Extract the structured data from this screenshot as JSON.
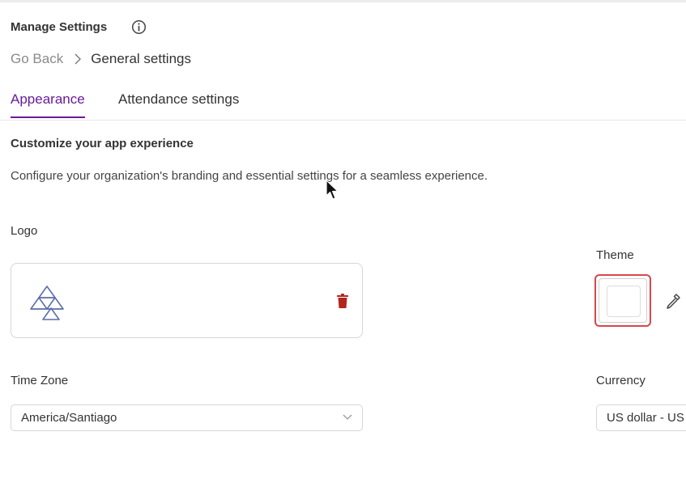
{
  "header": {
    "title": "Manage Settings"
  },
  "breadcrumb": {
    "back_label": "Go Back",
    "current_label": "General settings"
  },
  "tabs": [
    {
      "label": "Appearance",
      "active": true
    },
    {
      "label": "Attendance settings",
      "active": false
    }
  ],
  "section": {
    "title": "Customize your app experience",
    "description": "Configure your organization's branding and essential settings for a seamless experience."
  },
  "logo": {
    "label": "Logo",
    "icon": "triangle-logo-icon",
    "delete_icon": "trash-icon"
  },
  "theme": {
    "label": "Theme",
    "color": "#ffffff",
    "picker_icon": "eyedropper-icon",
    "highlight_color": "#d9464b"
  },
  "timezone": {
    "label": "Time Zone",
    "value": "America/Santiago"
  },
  "currency": {
    "label": "Currency",
    "value": "US dollar - US"
  },
  "colors": {
    "accent": "#6a1b9a",
    "delete": "#b3261e",
    "logo_stroke": "#5b6fa8"
  }
}
